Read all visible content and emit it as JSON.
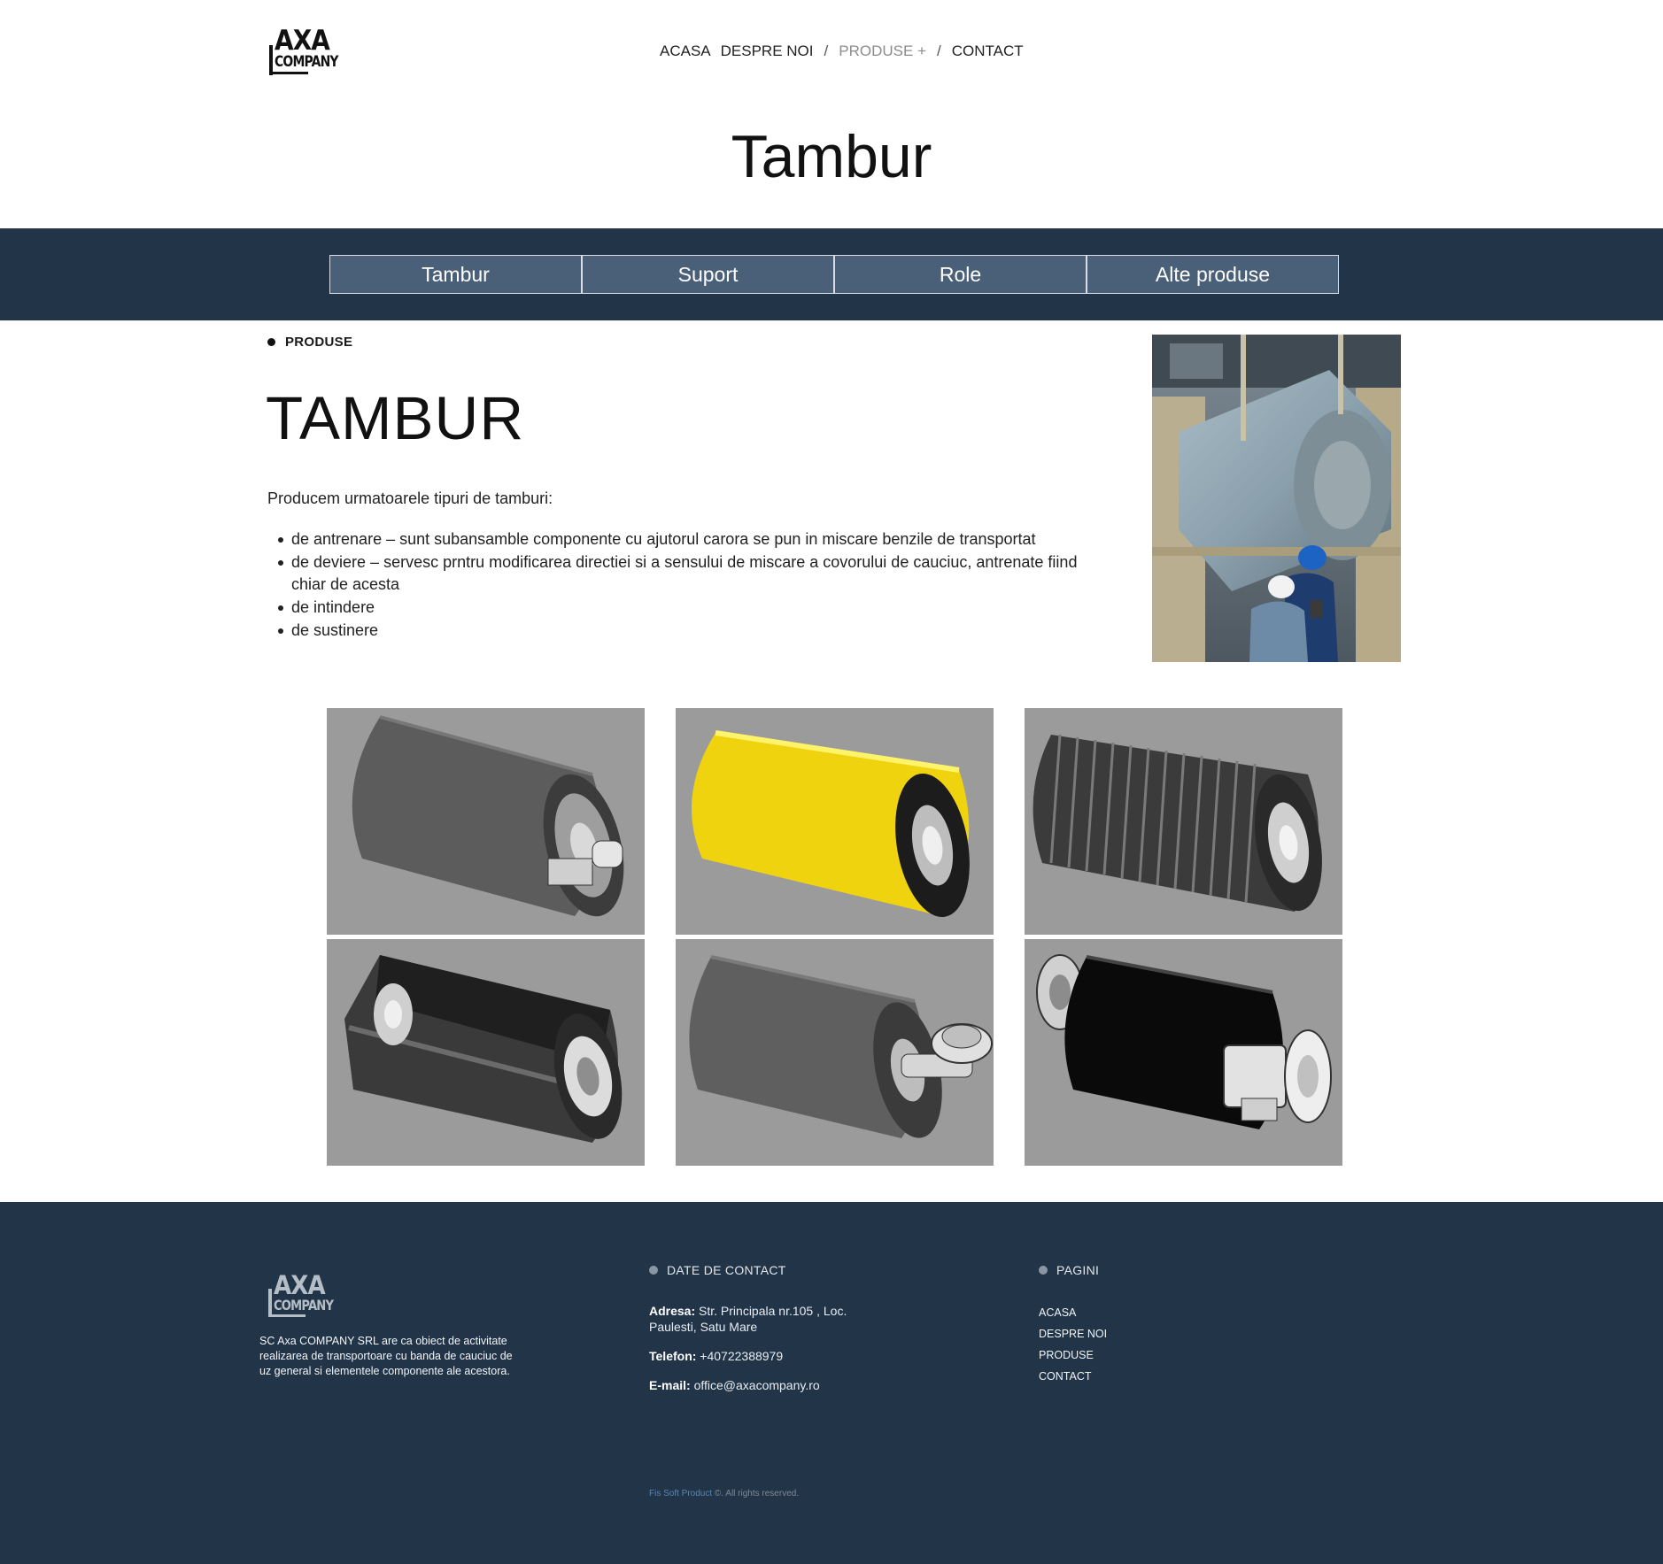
{
  "header": {
    "logo_line1": "AXA",
    "logo_line2": "COMPANY",
    "nav": {
      "acasa": "ACASA",
      "despre": "DESPRE NOI",
      "sep1": "/",
      "produse": "PRODUSE +",
      "sep2": "/",
      "contact": "CONTACT"
    },
    "page_title": "Tambur"
  },
  "tabs": [
    "Tambur",
    "Suport",
    "Role",
    "Alte produse"
  ],
  "main": {
    "breadcrumb": "PRODUSE",
    "title": "TAMBUR",
    "intro": "Producem urmatoarele tipuri de tamburi:",
    "bullets": [
      "de antrenare – sunt subansamble componente cu ajutorul carora se pun in miscare benzile de transportat",
      "de deviere – servesc prntru modificarea directiei si a sensului de miscare a covorului de cauciuc, antrenate fiind chiar de acesta",
      "de intindere",
      "de sustinere"
    ]
  },
  "products": [
    {
      "name": "drum-gray-plain",
      "color": "#5a5a5a"
    },
    {
      "name": "drum-yellow",
      "color": "#f2d20c"
    },
    {
      "name": "drum-ribbed",
      "color": "#3a3a3a"
    },
    {
      "name": "drum-cutaway",
      "color": "#3e3e3e"
    },
    {
      "name": "drum-gray-shaft",
      "color": "#5e5e5e"
    },
    {
      "name": "drum-black-motor",
      "color": "#0a0a0a"
    }
  ],
  "footer": {
    "logo_line1": "AXA",
    "logo_line2": "COMPANY",
    "about": "SC Axa COMPANY SRL are ca obiect de activitate realizarea de transportoare cu banda de cauciuc de uz general si elementele componente ale acestora.",
    "contact_heading": "DATE DE CONTACT",
    "address_label": "Adresa:",
    "address_value": "Str. Principala nr.105 , Loc. Paulesti, Satu Mare",
    "phone_label": "Telefon:",
    "phone_value": "+40722388979",
    "email_label": "E-mail:",
    "email_value": "office@axacompany.ro",
    "pages_heading": "PAGINI",
    "pages": [
      "ACASA",
      "DESPRE NOI",
      "PRODUSE",
      "CONTACT"
    ],
    "copyright_brand": "Fis Soft Product",
    "copyright_rest": " ©. All rights reserved."
  },
  "colors": {
    "band": "#213448",
    "tab_bg": "#4a5f78",
    "footer": "#213448"
  }
}
